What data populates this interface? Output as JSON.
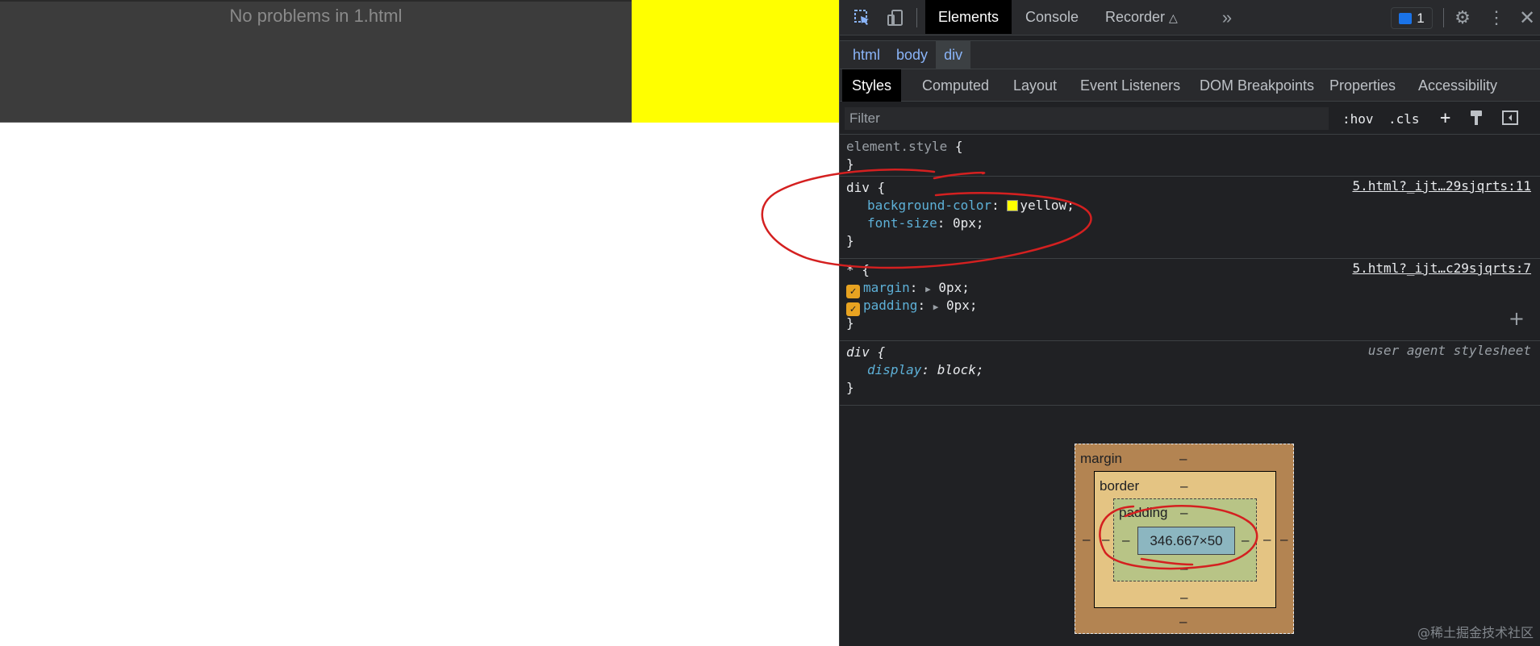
{
  "page": {
    "problems_text": "No problems in 1.html"
  },
  "devtools": {
    "main_tabs": [
      {
        "label": "Elements"
      },
      {
        "label": "Console"
      },
      {
        "label": "Recorder"
      }
    ],
    "issues_count": "1",
    "breadcrumb": [
      "html",
      "body",
      "div"
    ],
    "sub_tabs": [
      "Styles",
      "Computed",
      "Layout",
      "Event Listeners",
      "DOM Breakpoints",
      "Properties",
      "Accessibility"
    ],
    "filter": {
      "placeholder": "Filter",
      "hov": ":hov",
      "cls": ".cls"
    },
    "styles": {
      "element_style": {
        "selector": "element.style",
        "open": " {",
        "close": "}"
      },
      "div_rule": {
        "selector": "div",
        "source": "5.html?_ijt…29sjqrts:11",
        "decls": [
          {
            "name": "background-color",
            "value": "yellow;"
          },
          {
            "name": "font-size",
            "value": "0px;"
          }
        ]
      },
      "star_rule": {
        "selector": "*",
        "source": "5.html?_ijt…c29sjqrts:7",
        "decls": [
          {
            "name": "margin",
            "value": "0px;"
          },
          {
            "name": "padding",
            "value": "0px;"
          }
        ]
      },
      "ua_rule": {
        "selector": "div",
        "source": "user agent stylesheet",
        "decls": [
          {
            "name": "display",
            "value": "block;"
          }
        ]
      }
    },
    "box_model": {
      "margin_label": "margin",
      "border_label": "border",
      "padding_label": "padding",
      "content_size": "346.667×50",
      "dash": "–"
    }
  },
  "annotation_color": "#d42020",
  "watermark": "@稀土掘金技术社区",
  "icons": {
    "inspect": "inspect-element-icon",
    "device": "device-toolbar-icon",
    "recorder": "flask-icon",
    "more": "chevron-double-right-icon",
    "issues": "message-icon",
    "settings": "gear-icon",
    "kebab": "kebab-menu-icon",
    "close": "close-icon"
  }
}
